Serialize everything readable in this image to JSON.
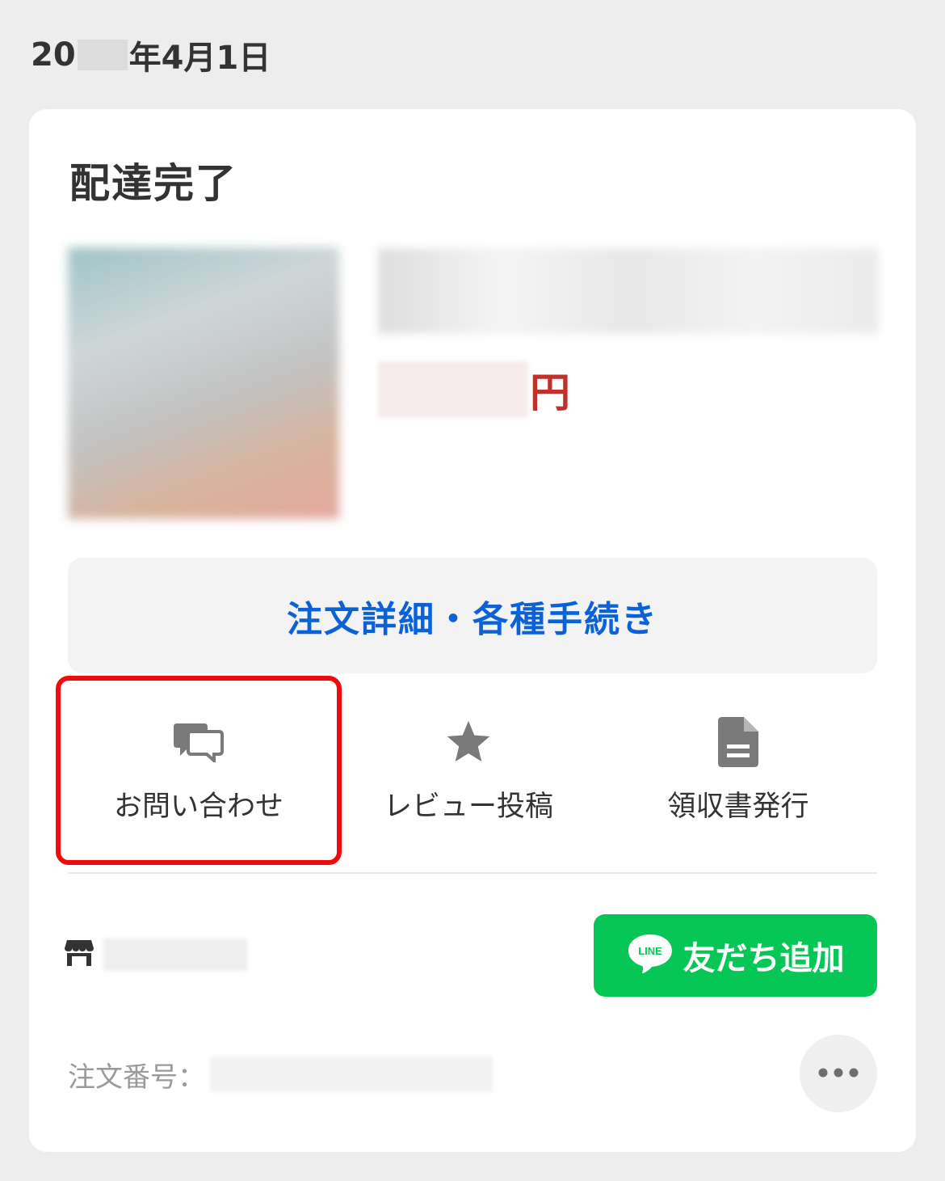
{
  "date": {
    "prefix": "20",
    "suffix": "年4月1日"
  },
  "order": {
    "status": "配達完了",
    "price_unit": "円",
    "detail_button_label": "注文詳細・各種手続き",
    "actions": [
      {
        "label": "お問い合わせ",
        "icon": "chat-bubbles-icon"
      },
      {
        "label": "レビュー投稿",
        "icon": "star-icon"
      },
      {
        "label": "領収書発行",
        "icon": "document-icon"
      }
    ],
    "line_button_label": "友だち追加",
    "line_logo_text": "LINE",
    "order_number_label": "注文番号："
  },
  "colors": {
    "accent_blue": "#0b62d6",
    "price_red": "#c0312b",
    "line_green": "#06c755",
    "highlight_red": "#f00a0a"
  }
}
